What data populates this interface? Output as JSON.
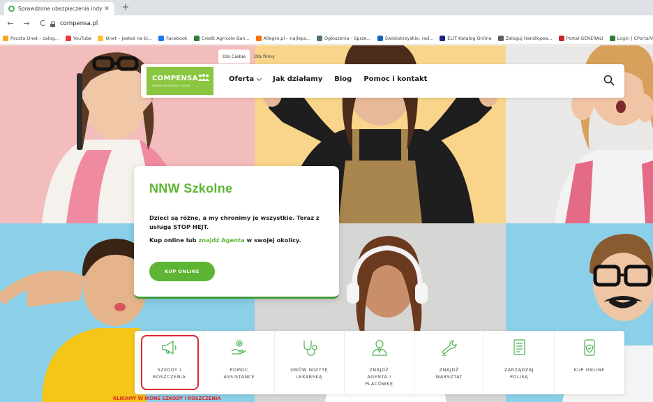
{
  "browser": {
    "tab_title": "Sprawdzone ubezpieczenia indy",
    "tab_close": "✕",
    "new_tab": "+",
    "url": "compensa.pl",
    "nav": {
      "back": "←",
      "forward": "→",
      "reload": "C"
    },
    "bookmarks": [
      {
        "label": "Poczta Onet – zalog...",
        "color": "#f5a623"
      },
      {
        "label": "YouTube",
        "color": "#e53935"
      },
      {
        "label": "Onet – Jesteś na bi...",
        "color": "#fbc02d"
      },
      {
        "label": "Facebook",
        "color": "#1877f2"
      },
      {
        "label": "Credit Agricole Ban...",
        "color": "#2e7d32"
      },
      {
        "label": "Allegro.pl – najleps...",
        "color": "#ff6d00"
      },
      {
        "label": "Ogłoszenia - Sprze...",
        "color": "#546e7a"
      },
      {
        "label": "Świetokrzyskie, rad...",
        "color": "#1565c0"
      },
      {
        "label": "ELIT Katalog Online",
        "color": "#1a237e"
      },
      {
        "label": "Zaloguj Handlopes...",
        "color": "#616161"
      },
      {
        "label": "Portal GENERALI",
        "color": "#c62828"
      },
      {
        "label": "Login | CPortalV4",
        "color": "#2e7d32"
      }
    ]
  },
  "site": {
    "segment_tabs": [
      "Dla Ciebie",
      "Dla firmy"
    ],
    "logo": {
      "word": "COMPENSA",
      "sub": "VIENNA INSURANCE GROUP"
    },
    "menu": [
      "Oferta",
      "Jak działamy",
      "Blog",
      "Pomoc i kontakt"
    ]
  },
  "hero": {
    "title": "NNW Szkolne",
    "text": "Dzieci są różne, a my chronimy je wszystkie. Teraz z usługą STOP HEJT.",
    "text2_before": "Kup online lub ",
    "text2_link": "znajdź Agenta",
    "text2_after": " w swojej okolicy.",
    "cta": "KUP ONLINE"
  },
  "quick_actions": [
    {
      "label": "SZKODY I\nROSZCZENIA",
      "icon": "megaphone-icon"
    },
    {
      "label": "POMOC\nASSISTANCE",
      "icon": "helping-hand-icon"
    },
    {
      "label": "UMÓW WIZYTĘ\nLEKARSKĄ",
      "icon": "stethoscope-icon"
    },
    {
      "label": "ZNAJDŹ\nAGENTA I\nPLACÓWKĘ",
      "icon": "agent-icon"
    },
    {
      "label": "ZNAJDŹ\nWARSZTAT",
      "icon": "wrench-icon"
    },
    {
      "label": "ZARZĄDZAJ\nPOLISĄ",
      "icon": "document-icon"
    },
    {
      "label": "KUP ONLINE",
      "icon": "phone-shield-icon"
    }
  ],
  "annotation": "KLIKAMY W IKONE SZKODY I ROSZCZENIA",
  "colors": {
    "brand_green": "#5db533",
    "logo_green": "#8ac63f",
    "highlight_red": "#e0262d",
    "panel_pink": "#f3bcbd",
    "panel_yellow": "#f8d58a",
    "panel_blue": "#8bd0e8",
    "panel_gray": "#d6d6d4"
  }
}
